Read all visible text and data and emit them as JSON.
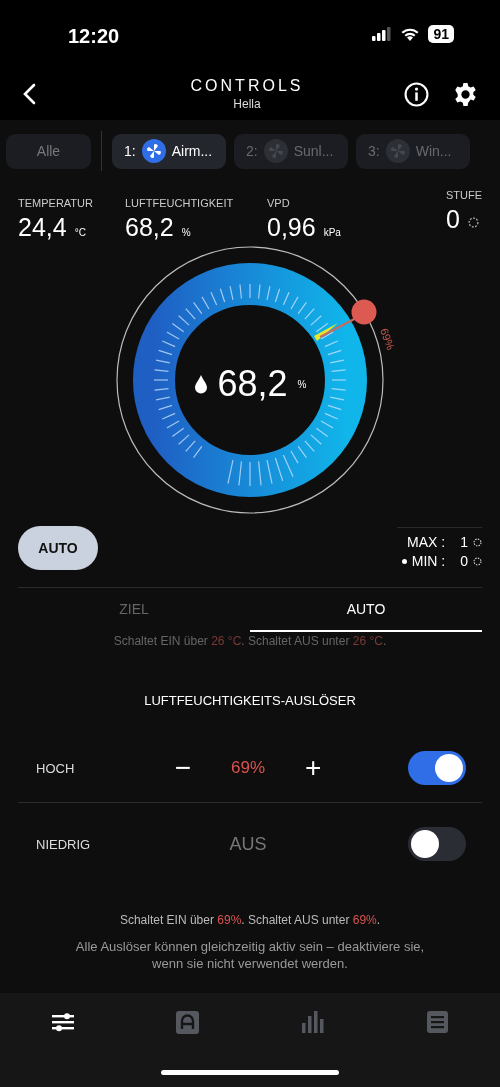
{
  "status_bar": {
    "time": "12:20",
    "battery": "91"
  },
  "header": {
    "title": "CONTROLS",
    "subtitle": "Hella"
  },
  "chips": [
    {
      "label": "Alle",
      "kind": "all",
      "selected": false
    },
    {
      "label": "1:",
      "name": "Airm...",
      "kind": "device",
      "selected": true
    },
    {
      "label": "2:",
      "name": "Sunl...",
      "kind": "device",
      "selected": false
    },
    {
      "label": "3:",
      "name": "Win...",
      "kind": "device",
      "selected": false
    }
  ],
  "readings": [
    {
      "label": "TEMPERATUR",
      "value": "24,4",
      "unit": "°C"
    },
    {
      "label": "LUFTFEUCHTIGKEIT",
      "value": "68,2",
      "unit": "%"
    },
    {
      "label": "VPD",
      "value": "0,96",
      "unit": "kPa"
    }
  ],
  "stufe": {
    "label": "STUFE",
    "value": "0"
  },
  "gauge": {
    "value": "68,2",
    "unit": "%",
    "setpoint": "69%"
  },
  "mode_button": "AUTO",
  "limits": [
    {
      "label": "MAX :",
      "value": "1",
      "selected": false
    },
    {
      "label": "MIN :",
      "value": "0",
      "selected": true
    }
  ],
  "tabs": [
    {
      "label": "ZIEL",
      "selected": false
    },
    {
      "label": "AUTO",
      "selected": true
    }
  ],
  "hidden_note": [
    {
      "text": "Schaltet EIN über ",
      "highlight": false
    },
    {
      "text": "26 °C",
      "highlight": true
    },
    {
      "text": ". Schaltet AUS unter ",
      "highlight": false
    },
    {
      "text": "26 °C",
      "highlight": true
    },
    {
      "text": ".",
      "highlight": false
    }
  ],
  "section_title": "LUFTFEUCHTIGKEITS-AUSLÖSER",
  "triggers": [
    {
      "label": "HOCH",
      "kind": "stepper",
      "value": "69%",
      "minus": "−",
      "plus": "+",
      "on": true
    },
    {
      "label": "NIEDRIG",
      "kind": "off",
      "value": "AUS",
      "on": false
    }
  ],
  "note": [
    {
      "text": "Schaltet EIN über ",
      "highlight": false
    },
    {
      "text": "69%",
      "highlight": true
    },
    {
      "text": ". Schaltet AUS unter ",
      "highlight": false
    },
    {
      "text": "69%",
      "highlight": true
    },
    {
      "text": ".",
      "highlight": false
    }
  ],
  "hint": "Alle Auslöser können gleichzeitig aktiv sein – deaktiviere sie, wenn sie nicht verwendet werden.",
  "nav": [
    {
      "kind": "sliders",
      "selected": true
    },
    {
      "kind": "auto",
      "selected": false
    },
    {
      "kind": "chart",
      "selected": false
    },
    {
      "kind": "list",
      "selected": false
    }
  ]
}
